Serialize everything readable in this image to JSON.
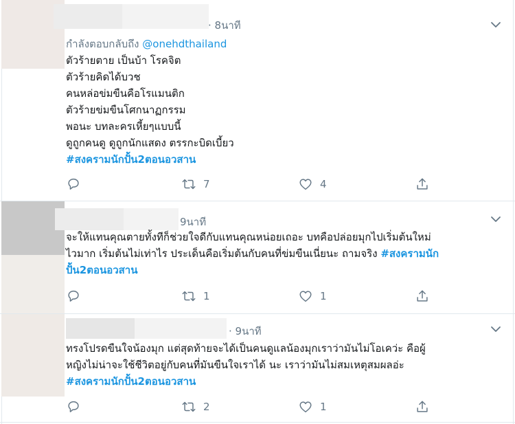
{
  "tweets": [
    {
      "time": "· 8นาที",
      "replying_prefix": "กำลังตอบกลับถึง",
      "replying_handle": "@onehdthailand",
      "body": "ตัวร้ายตาย เป็นบ้า โรคจิต\nตัวร้ายคิดได้บวช\nคนหล่อข่มขืนคือโรแมนติก\nตัวร้ายข่มขืนโศกนาฏกรรม\nพอนะ บทละครเหี้ยๆแบบนี้\nดูถูกคนดู ดูถูกนักแสดง ตรรกะบิดเบี้ยว",
      "hashtag": "#สงครามนักปั้น2ตอนอวสาน",
      "retweets": "7",
      "likes": "4"
    },
    {
      "time": "9นาที",
      "body": "จะให้แทนคุณตายทั้งทีก็ช่วยใจดีกับแทนคุณหน่อยเถอะ บทคือปล่อยมุกไปเริ่มต้นใหม่\nไวมาก เริ่มต้นไม่เท่าไร ประเด็นคือเริ่มต้นกับคนที่ข่มขืนเนี่ยนะ  ถามจริง",
      "hashtag_inline": "#สงครามนัก",
      "hashtag_cont": "ปั้น2ตอนอวสาน",
      "retweets": "1",
      "likes": "1"
    },
    {
      "time": "· 9นาที",
      "body": "ทรงโปรดขืนใจน้องมุก แต่สุดท้ายจะได้เป็นคนดูแลน้องมุกเราว่ามันไม่โอเคว่ะ คือผู้\nหญิงไม่น่าจะใช้ชีวิตอยู่กับคนที่มันขืนใจเราได้ นะ เราว่ามันไม่สมเหตุสมผลอ่ะ",
      "hashtag": "#สงครามนักปั้น2ตอนอวสาน",
      "retweets": "2",
      "likes": "1"
    }
  ],
  "icons": {
    "reply": "reply-icon",
    "retweet": "retweet-icon",
    "like": "like-icon",
    "share": "share-icon",
    "more": "chevron-down-icon"
  },
  "colors": {
    "accent": "#1b95e0",
    "muted": "#657786",
    "text": "#14171a",
    "divider": "#e1e8ed"
  }
}
